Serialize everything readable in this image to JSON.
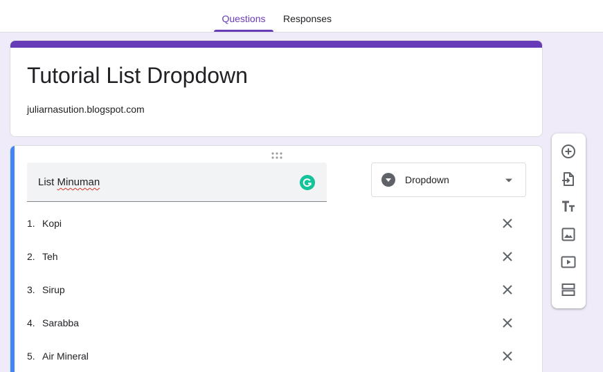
{
  "tabs": {
    "questions": "Questions",
    "responses": "Responses"
  },
  "form": {
    "title": "Tutorial List Dropdown",
    "description": "juliarnasution.blogspot.com"
  },
  "question": {
    "title_prefix": "List ",
    "title_misspelled": "Minuman",
    "type": "Dropdown",
    "options": [
      {
        "num": "1.",
        "label": "Kopi"
      },
      {
        "num": "2.",
        "label": "Teh"
      },
      {
        "num": "3.",
        "label": "Sirup"
      },
      {
        "num": "4.",
        "label": "Sarabba"
      },
      {
        "num": "5.",
        "label": "Air Mineral"
      }
    ]
  },
  "toolbar_icons": [
    "add-question-icon",
    "import-questions-icon",
    "add-title-icon",
    "add-image-icon",
    "add-video-icon",
    "add-section-icon"
  ],
  "colors": {
    "accent": "#673ab7",
    "active_question_bar": "#4285f4",
    "background": "#f0ebf8",
    "grammarly": "#15c39a"
  }
}
